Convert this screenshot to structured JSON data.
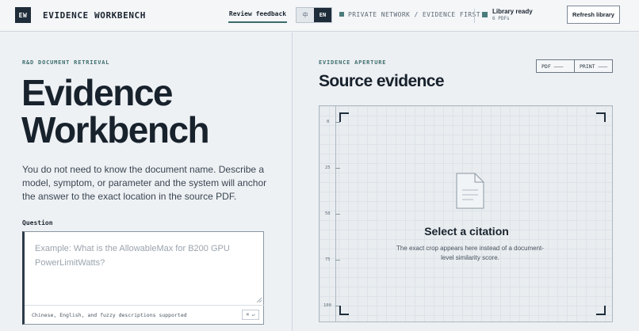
{
  "header": {
    "logo_text": "EW",
    "app_title": "EVIDENCE WORKBENCH",
    "review_link": "Review feedback",
    "lang_zh": "中",
    "lang_en": "EN",
    "network_status": "PRIVATE NETWORK / EVIDENCE FIRST",
    "library_status": "Library ready",
    "library_count": "6 PDFs",
    "refresh_button": "Refresh library"
  },
  "left": {
    "eyebrow": "R&D DOCUMENT RETRIEVAL",
    "title_line1": "Evidence",
    "title_line2": "Workbench",
    "description": "You do not need to know the document name. Describe a model, symptom, or parameter and the system will anchor the answer to the exact location in the source PDF.",
    "question_label": "Question",
    "question_placeholder": "Example: What is the AllowableMax for B200 GPU PowerLimitWatts?",
    "question_value": "",
    "hint": "Chinese, English, and fuzzy descriptions supported",
    "submit_kbd": "⌘ ↵"
  },
  "right": {
    "eyebrow": "EVIDENCE APERTURE",
    "title": "Source evidence",
    "pdf_button": "PDF ———",
    "print_button": "PRINT ———",
    "ruler_ticks": [
      "0",
      "25",
      "50",
      "75",
      "100"
    ],
    "empty_title": "Select a citation",
    "empty_subtitle": "The exact crop appears here instead of a document-level similarity score."
  },
  "colors": {
    "accent": "#3d6d6d",
    "dark": "#1f2d3a",
    "status_dot": "#4a7c7c"
  },
  "icons": [
    "document-icon",
    "resize-grip-icon"
  ]
}
